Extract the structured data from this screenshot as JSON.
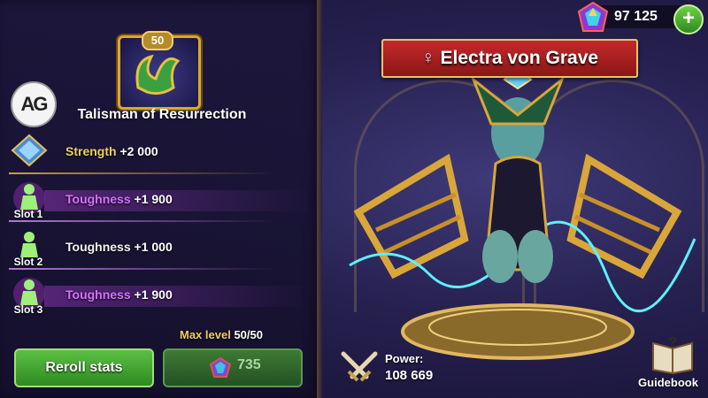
{
  "talisman": {
    "level": "50",
    "name": "Talisman of Resurrection"
  },
  "logo": {
    "text": "AG"
  },
  "stats": [
    {
      "name": "Strength",
      "value": "+2 000",
      "slot": "",
      "style": "gold"
    },
    {
      "name": "Toughness",
      "value": "+1 900",
      "slot": "Slot 1",
      "style": "purple"
    },
    {
      "name": "Toughness",
      "value": "+1 000",
      "slot": "Slot 2",
      "style": "plain"
    },
    {
      "name": "Toughness",
      "value": "+1 900",
      "slot": "Slot 3",
      "style": "purple"
    }
  ],
  "max_level": {
    "label": "Max level",
    "value": "50/50"
  },
  "buttons": {
    "reroll_label": "Reroll stats",
    "cost_value": "735"
  },
  "currency": {
    "value": "97 125",
    "plus": "+"
  },
  "hero": {
    "name": "Electra von Grave",
    "gender_symbol": "♀"
  },
  "power": {
    "label": "Power:",
    "value": "108 669"
  },
  "guidebook": {
    "label": "Guidebook"
  },
  "colors": {
    "stat_purple": "#d673ff",
    "stat_gold": "#f0d060",
    "banner_red": "#c42a2a",
    "button_green": "#4aa83a"
  }
}
